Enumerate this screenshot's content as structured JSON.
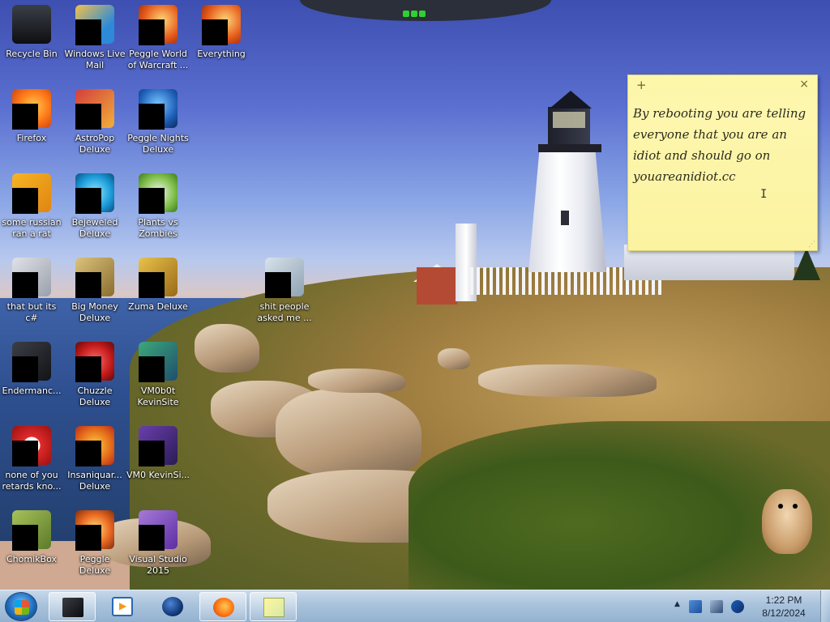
{
  "desktop": {
    "icons": [
      {
        "label": "Recycle Bin",
        "icon": "recycle-bin-icon",
        "g": "g-bin"
      },
      {
        "label": "Windows Live Mail",
        "icon": "windows-live-mail-icon",
        "g": "g-mail"
      },
      {
        "label": "Peggle World of Warcraft ...",
        "icon": "peggle-wow-icon",
        "g": "g-orange"
      },
      {
        "label": "Everything",
        "icon": "everything-search-icon",
        "g": "g-orange"
      },
      {
        "label": "Firefox",
        "icon": "firefox-icon",
        "g": "g-fox"
      },
      {
        "label": "AstroPop Deluxe",
        "icon": "astropop-icon",
        "g": "g-astro"
      },
      {
        "label": "Peggle Nights Deluxe",
        "icon": "peggle-nights-icon",
        "g": "g-peggle"
      },
      {
        "label": "some russian ran a rat",
        "icon": "rat-app-icon",
        "g": "g-orange-sq"
      },
      {
        "label": "Bejeweled Deluxe",
        "icon": "bejeweled-icon",
        "g": "g-bejeweled"
      },
      {
        "label": "Plants vs Zombies",
        "icon": "plants-vs-zombies-icon",
        "g": "g-plants"
      },
      {
        "label": "that but its c#",
        "icon": "csharp-stack-icon",
        "g": "g-stack"
      },
      {
        "label": "Big Money Deluxe",
        "icon": "big-money-icon",
        "g": "g-money"
      },
      {
        "label": "Zuma Deluxe",
        "icon": "zuma-icon",
        "g": "g-zuma"
      },
      {
        "label": "shit people asked me ...",
        "icon": "folder-icon",
        "g": "g-folder"
      },
      {
        "label": "Endermanc...",
        "icon": "endermanch-icon",
        "g": "g-ender"
      },
      {
        "label": "Chuzzle Deluxe",
        "icon": "chuzzle-icon",
        "g": "g-chuzzle"
      },
      {
        "label": "VM0b0t KevinSite",
        "icon": "vm-kevinsite-icon",
        "g": "g-vm"
      },
      {
        "label": "none of you retards kno...",
        "icon": "opera-icon",
        "g": "g-opera"
      },
      {
        "label": "Insaniquar... Deluxe",
        "icon": "insaniquarium-icon",
        "g": "g-insani"
      },
      {
        "label": "VM0 KevinSi...",
        "icon": "vm-kevinsite-2-icon",
        "g": "g-vm2"
      },
      {
        "label": "ChomikBox",
        "icon": "chomikbox-icon",
        "g": "g-chomik"
      },
      {
        "label": "Peggle Deluxe",
        "icon": "peggle-deluxe-icon",
        "g": "g-peggle2"
      },
      {
        "label": "Visual Studio 2015",
        "icon": "visual-studio-icon",
        "g": "g-vs"
      }
    ]
  },
  "sticky_note": {
    "text": "By rebooting you are telling everyone that you are an idiot and should go on youareanidiot.cc",
    "add_glyph": "+",
    "close_glyph": "×"
  },
  "taskbar": {
    "pinned": [
      {
        "name": "taskbar-terminal",
        "icon": "terminal-icon",
        "cls": "gl-term",
        "active": true
      },
      {
        "name": "taskbar-media-player",
        "icon": "media-player-icon",
        "cls": "gl-media",
        "active": false
      },
      {
        "name": "taskbar-browser",
        "icon": "globe-icon",
        "cls": "gl-globe",
        "active": false
      },
      {
        "name": "taskbar-firefox",
        "icon": "firefox-icon",
        "cls": "gl-fox",
        "active": true
      },
      {
        "name": "taskbar-sticky-notes",
        "icon": "sticky-notes-icon",
        "cls": "gl-note",
        "active": true
      }
    ],
    "clock": {
      "time": "1:22 PM",
      "date": "8/12/2024"
    }
  }
}
